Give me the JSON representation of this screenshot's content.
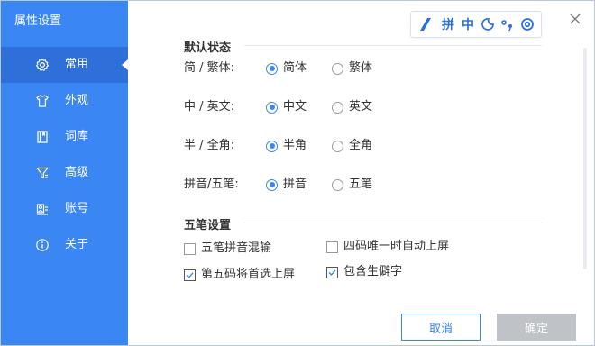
{
  "window": {
    "title": "属性设置"
  },
  "sidebar": {
    "items": [
      {
        "label": "常用",
        "icon": "gear-icon"
      },
      {
        "label": "外观",
        "icon": "tshirt-icon"
      },
      {
        "label": "词库",
        "icon": "book-icon"
      },
      {
        "label": "高级",
        "icon": "filter-icon"
      },
      {
        "label": "账号",
        "icon": "account-icon"
      },
      {
        "label": "关于",
        "icon": "info-icon"
      }
    ],
    "active_index": 0
  },
  "toolbar": {
    "items": [
      "logo-icon",
      "拼",
      "中",
      "moon-icon",
      "punctuation-icon",
      "settings-icon"
    ],
    "pin_label": "拼",
    "zh_label": "中"
  },
  "sections": {
    "default_state": {
      "title": "默认状态",
      "rows": [
        {
          "label": "简 / 繁体:",
          "options": [
            "简体",
            "繁体"
          ],
          "selected": 0
        },
        {
          "label": "中 / 英文:",
          "options": [
            "中文",
            "英文"
          ],
          "selected": 0
        },
        {
          "label": "半 / 全角:",
          "options": [
            "半角",
            "全角"
          ],
          "selected": 0
        },
        {
          "label": "拼音/五笔:",
          "options": [
            "拼音",
            "五笔"
          ],
          "selected": 0
        }
      ]
    },
    "wubi": {
      "title": "五笔设置",
      "options": [
        {
          "label": "五笔拼音混输",
          "checked": false
        },
        {
          "label": "四码唯一时自动上屏",
          "checked": false
        },
        {
          "label": "第五码将首选上屏",
          "checked": true
        },
        {
          "label": "包含生僻字",
          "checked": true
        }
      ]
    }
  },
  "buttons": {
    "cancel": "取消",
    "ok": "确定"
  },
  "colors": {
    "accent": "#3a86f2",
    "sidebar_active": "#2e6fd9",
    "ok_disabled": "#bfc3c8"
  }
}
